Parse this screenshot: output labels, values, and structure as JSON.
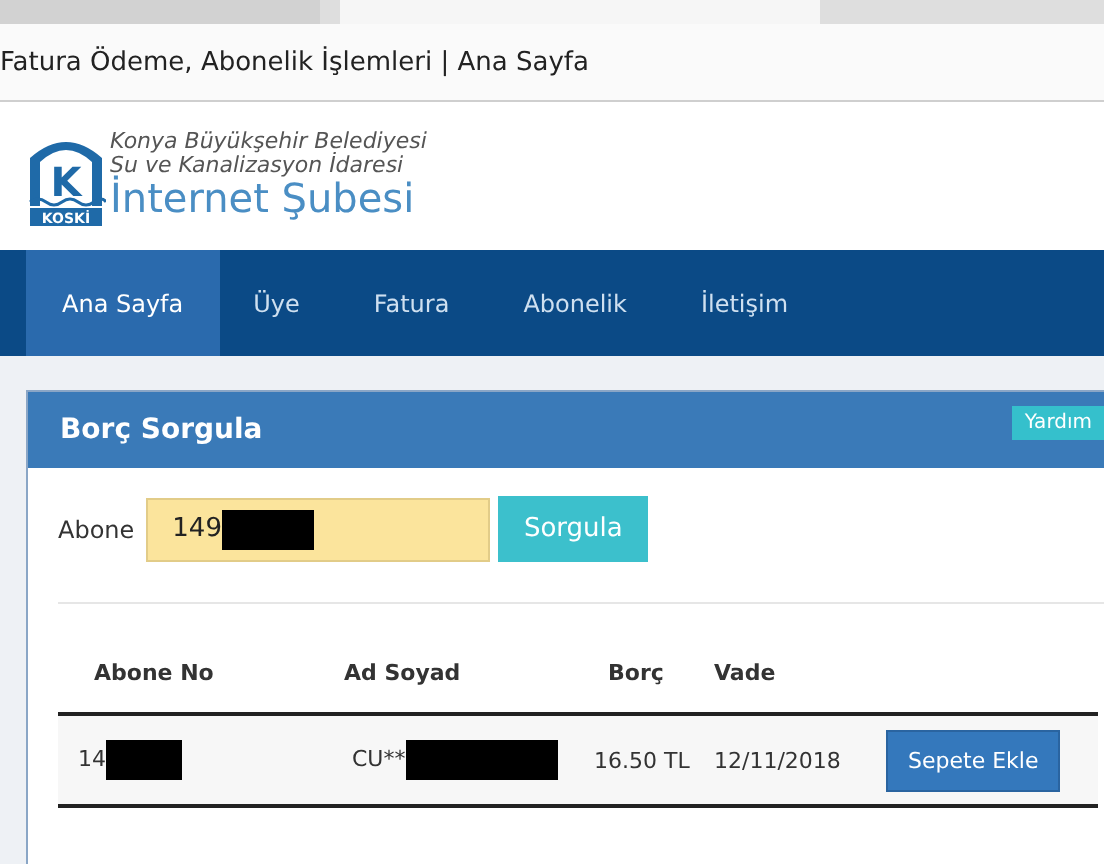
{
  "browser": {
    "page_title": "Fatura Ödeme, Abonelik İşlemleri | Ana Sayfa"
  },
  "header": {
    "org_line_1": "Konya Büyükşehir Belediyesi",
    "org_line_2": "Su ve Kanalizasyon İdaresi",
    "site_name": "İnternet Şubesi",
    "logo_text": "KOSKİ",
    "logo_letter": "K"
  },
  "nav": [
    {
      "label": "Ana Sayfa",
      "selected": true
    },
    {
      "label": "Üye",
      "selected": false
    },
    {
      "label": "Fatura",
      "selected": false
    },
    {
      "label": "Abonelik",
      "selected": false
    },
    {
      "label": "İletişim",
      "selected": false
    }
  ],
  "panel": {
    "title": "Borç Sorgula",
    "help": "Yardım",
    "form": {
      "label": "Abone",
      "value": "149",
      "redacted": true,
      "button": "Sorgula"
    },
    "table": {
      "columns": [
        "Abone No",
        "Ad Soyad",
        "Borç",
        "Vade"
      ],
      "rows": [
        {
          "abone_no": "14",
          "ad_soyad": "CU**",
          "redacted": true,
          "borc": "16.50 TL",
          "vade": "12/11/2018",
          "action": "Sepete Ekle"
        }
      ]
    }
  }
}
